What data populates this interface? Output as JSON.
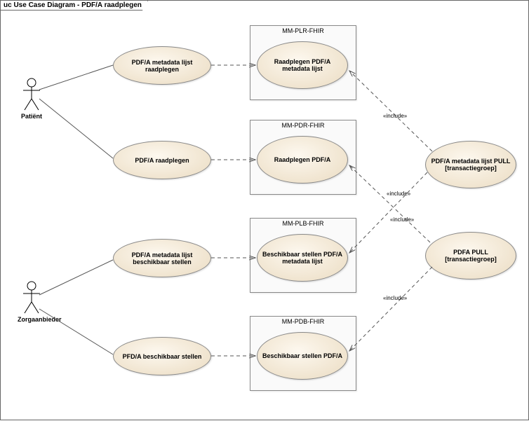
{
  "diagram": {
    "frameTitle": "uc Use Case Diagram - PDF/A raadplegen",
    "actors": {
      "patient": "Patiënt",
      "zorgaanbieder": "Zorgaanbieder"
    },
    "usecases": {
      "uc1": "PDF/A metadata lijst raadplegen",
      "uc2": "PDF/A raadplegen",
      "uc3": "PDF/A metadata lijst beschikbaar stellen",
      "uc4": "PFD/A beschikbaar stellen",
      "sys1": "Raadplegen PDF/A metadata lijst",
      "sys2": "Raadplegen PDF/A",
      "sys3": "Beschikbaar stellen PDF/A metadata lijst",
      "sys4": "Beschikbaar stellen PDF/A",
      "grp1": "PDF/A metadata lijst PULL [transactiegroep]",
      "grp2": "PDFA PULL [transactiegroep]"
    },
    "systems": {
      "s1": "MM-PLR-FHIR",
      "s2": "MM-PDR-FHIR",
      "s3": "MM-PLB-FHIR",
      "s4": "MM-PDB-FHIR"
    },
    "stereotype": "«include»"
  }
}
